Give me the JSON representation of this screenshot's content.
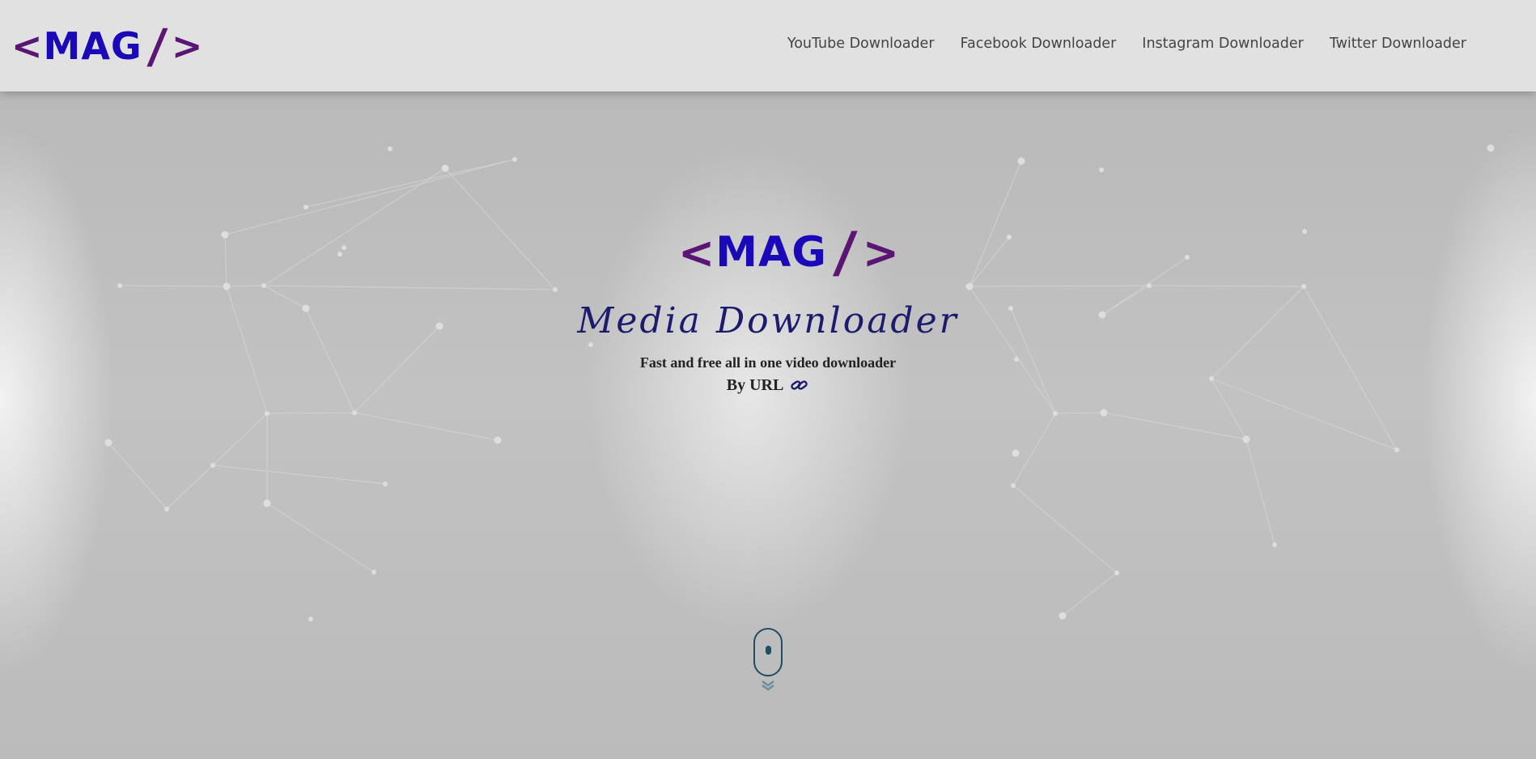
{
  "header": {
    "logo": {
      "left_bracket": "<",
      "text": "MAG",
      "slash": "/",
      "right_bracket": ">"
    },
    "nav": [
      {
        "label": "YouTube Downloader"
      },
      {
        "label": "Facebook Downloader"
      },
      {
        "label": "Instagram Downloader"
      },
      {
        "label": "Twitter Downloader"
      }
    ]
  },
  "hero": {
    "logo": {
      "left_bracket": "<",
      "text": "MAG",
      "slash": "/",
      "right_bracket": ">"
    },
    "title": "Media Downloader",
    "subtitle": "Fast and free all in one video downloader",
    "by_url_label": "By URL",
    "link_icon": "link-icon",
    "scroll_icon": "mouse-scroll-icon"
  },
  "colors": {
    "logo_text": "#1a09b8",
    "logo_bracket": "#5b1574",
    "title": "#1c1b6e",
    "header_bg": "#e1e1e1",
    "scroll_indicator": "#1f4e62"
  }
}
